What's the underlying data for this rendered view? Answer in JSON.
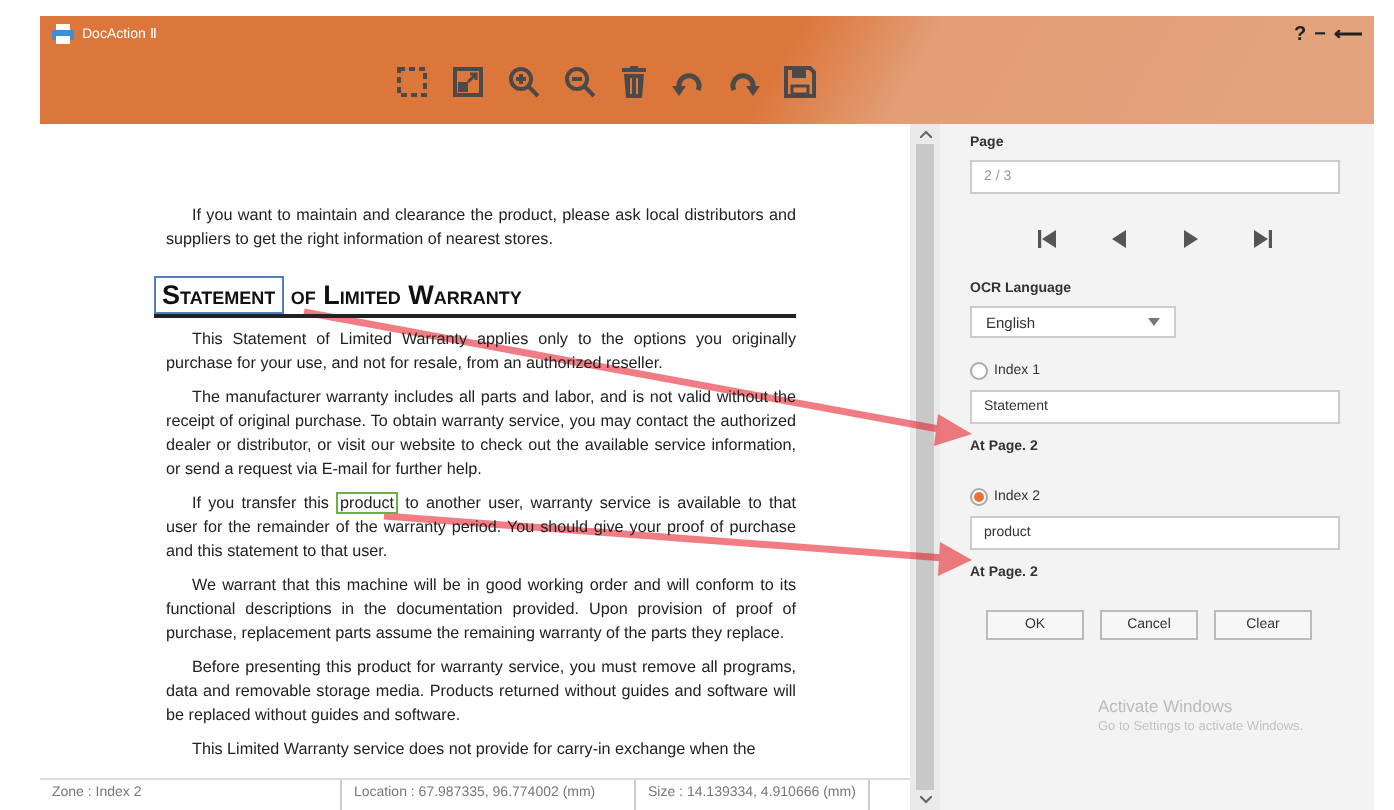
{
  "window": {
    "title": "DocAction Ⅱ",
    "controls": [
      "?",
      "−",
      "⟵"
    ]
  },
  "document": {
    "paragraphs": [
      {
        "kind": "text",
        "segments": [
          {
            "text": "If you want to maintain and clearance the product, please ask local distributors and suppliers to get the right information of nearest stores."
          }
        ]
      },
      {
        "kind": "heading",
        "segments": [
          {
            "text": "Statement",
            "color": "#4f7fbf"
          },
          {
            "text": " of Limited Warranty"
          }
        ]
      },
      {
        "kind": "text",
        "segments": [
          {
            "text": "This Statement of Limited Warranty applies only to the options you originally purchase for your use, and not for resale, from an authorized reseller."
          }
        ]
      },
      {
        "kind": "text",
        "segments": [
          {
            "text": "The manufacturer warranty includes all parts and labor, and is not valid without the receipt of original purchase. To obtain warranty service, you may contact the authorized dealer or distributor, or visit our website to check out the available service information, or send a request via E-mail for further help."
          }
        ]
      },
      {
        "kind": "text",
        "segments": [
          {
            "text": "If you transfer this "
          },
          {
            "text": "product",
            "color": "#6ab04c"
          },
          {
            "text": " to another user, warranty service is available to that user for the remainder of the warranty period. You should give your proof of purchase and this statement to that user."
          }
        ]
      },
      {
        "kind": "text",
        "segments": [
          {
            "text": "We warrant that this machine will be in good working order and will conform to its functional descriptions in the documentation provided. Upon provision of proof of purchase, replacement parts assume the remaining warranty of the parts they replace."
          }
        ]
      },
      {
        "kind": "text",
        "segments": [
          {
            "text": "Before presenting this product for warranty service, you must remove all programs, data and removable storage media. Products returned without guides and software will be replaced without guides and software."
          }
        ]
      },
      {
        "kind": "text",
        "segments": [
          {
            "text": "This Limited Warranty service does not provide for carry-in exchange when the"
          }
        ]
      }
    ]
  },
  "status_bar": [
    "Zone : Index 2",
    "Location : 67.987335, 96.774002 (mm)",
    "Size : 14.139334, 4.910666 (mm)"
  ],
  "panel": {
    "page_label": "Page",
    "page_value": "2 / 3",
    "ocr_label": "OCR Language",
    "ocr_value": "English",
    "indexes": [
      {
        "label": "Index 1",
        "selected": false,
        "value": "Statement",
        "page": "At Page. 2"
      },
      {
        "label": "Index 2",
        "selected": true,
        "value": "product",
        "page": "At Page. 2"
      }
    ],
    "buttons": [
      "OK",
      "Cancel",
      "Clear"
    ],
    "activation": {
      "title": "Activate Windows",
      "subtitle": "Go to Settings to activate Windows."
    }
  }
}
